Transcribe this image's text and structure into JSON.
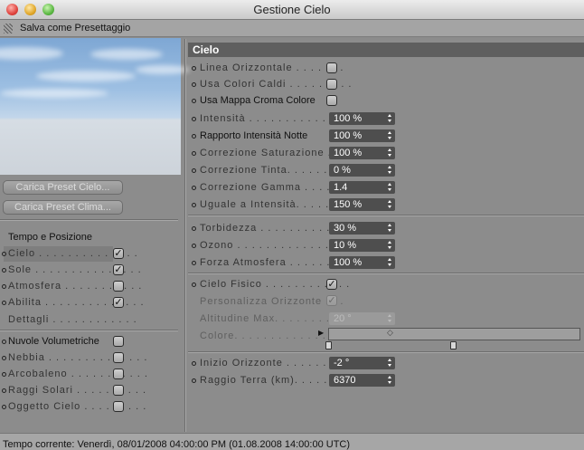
{
  "window": {
    "title": "Gestione Cielo"
  },
  "menubar": {
    "item": "Salva come Presettaggio"
  },
  "left": {
    "buttons": [
      "Carica Preset Cielo...",
      "Carica Preset Clima..."
    ],
    "section_title": "Tempo e Posizione",
    "items": [
      {
        "label": "Cielo . . . . . . . . . . . . . .",
        "checked": true,
        "selected": true
      },
      {
        "label": "Sole . . . . . . . . . . . . . . .",
        "checked": true
      },
      {
        "label": "Atmosfera . . . . . . . . . . .",
        "checked": false
      },
      {
        "label": "Abilita . . . . . . . . . . . . . .",
        "checked": true
      }
    ],
    "dettagli": "Dettagli . . . . . . . . . . . .",
    "items2": [
      {
        "label": "Nuvole Volumetriche",
        "checked": false
      },
      {
        "label": "Nebbia . . . . . . . . . . . . . .",
        "checked": false
      },
      {
        "label": "Arcobaleno . . . . . . . . . . .",
        "checked": false
      },
      {
        "label": "Raggi Solari . . . . . . . . . .",
        "checked": false
      },
      {
        "label": "Oggetto Cielo . . . . . . . . .",
        "checked": false
      }
    ]
  },
  "right": {
    "header": "Cielo",
    "checks": [
      {
        "label": "Linea Orizzontale . . . . . . .",
        "checked": false
      },
      {
        "label": "Usa Colori Caldi . . . . . . . . .",
        "checked": false
      },
      {
        "label": "Usa Mappa Croma Colore",
        "checked": false
      }
    ],
    "fields1": [
      {
        "label": "Intensità . . . . . . . . . . . . . . .",
        "value": "100 %"
      },
      {
        "label": "Rapporto Intensità Notte",
        "value": "100 %"
      },
      {
        "label": "Correzione Saturazione . .",
        "value": "100 %"
      },
      {
        "label": "Correzione Tinta. . . . . . . . . .",
        "value": "0 %"
      },
      {
        "label": "Correzione Gamma . . . . . .",
        "value": "1.4"
      },
      {
        "label": "Uguale a Intensità. . . . . . .",
        "value": "150 %"
      }
    ],
    "fields2": [
      {
        "label": "Torbidezza . . . . . . . . . . . . .",
        "value": "30 %"
      },
      {
        "label": "Ozono . . . . . . . . . . . . . . . . .",
        "value": "10 %"
      },
      {
        "label": "Forza Atmosfera . . . . . . . .",
        "value": "100 %"
      }
    ],
    "cielo_fisico": {
      "label": "Cielo Fisico . . . . . . . . . . . .",
      "checked": true
    },
    "personalizza": {
      "label": "Personalizza Orizzonte . . .",
      "checked": true
    },
    "altitudine": {
      "label": "Altitudine Max. . . . . . . . . .",
      "value": "20 °"
    },
    "colore": {
      "label": "Colore. . . . . . . . . . . . . . . . ."
    },
    "fields3": [
      {
        "label": "Inizio Orizzonte . . . . . . . . .",
        "value": "-2 °"
      },
      {
        "label": "Raggio Terra (km). . . . . . . .",
        "value": "6370"
      }
    ]
  },
  "status": {
    "text": "Tempo corrente:  Venerdì, 08/01/2008 04:00:00 PM  (01.08.2008  14:00:00 UTC)"
  }
}
